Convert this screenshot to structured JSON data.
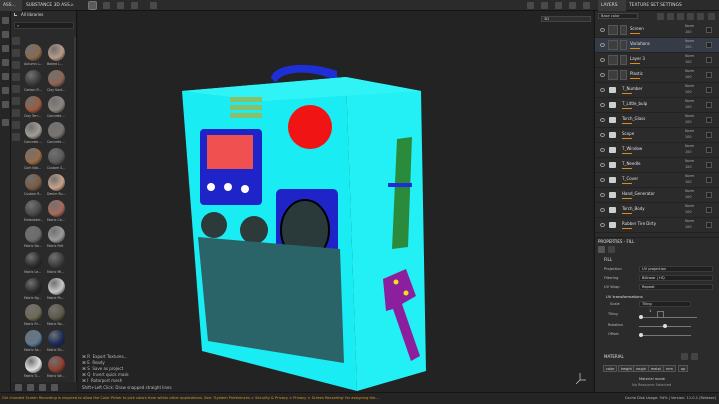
{
  "top_tabs": [
    {
      "label": "ASS..."
    },
    {
      "label": "SUBSTANCE 3D ASS..."
    },
    {
      "label": "LAYERS"
    },
    {
      "label": "TEXTURE SET SETTINGS"
    }
  ],
  "viewport": {
    "material_dropdown": "Base color",
    "camera_dropdown": "3D",
    "shortcuts": [
      {
        "key": "⌘ R",
        "label": "Export Textures..."
      },
      {
        "key": "⌘ E",
        "label": "Ready"
      },
      {
        "key": "⌘ S",
        "label": "Save as project"
      },
      {
        "key": "⌘ Q",
        "label": "Invert quick mask"
      },
      {
        "key": "⌘ I",
        "label": "Rotorport mesh"
      }
    ],
    "hint": "Shift+Left Click: Draw snapped straight lines"
  },
  "shelf": {
    "title": "All libraries",
    "search_placeholder": "",
    "items": [
      {
        "label": "Autumn L...",
        "color": "#8a6a4c"
      },
      {
        "label": "Baked L...",
        "color": "#b89a86"
      },
      {
        "label": "Carbon Fi...",
        "color": "#3a3a3a"
      },
      {
        "label": "Clay Sant...",
        "color": "#8d6654"
      },
      {
        "label": "Clay Terr...",
        "color": "#9b5a3d"
      },
      {
        "label": "Concrete ...",
        "color": "#8b8680"
      },
      {
        "label": "Concrete ...",
        "color": "#a19c96"
      },
      {
        "label": "Concrete ...",
        "color": "#797470"
      },
      {
        "label": "Cork Nat...",
        "color": "#9a6b46"
      },
      {
        "label": "Custom S...",
        "color": "#5a5a5a"
      },
      {
        "label": "Custom R...",
        "color": "#7a5a44"
      },
      {
        "label": "Denim Ru...",
        "color": "#c9a28a"
      },
      {
        "label": "Embroider...",
        "color": "#4a4a4a"
      },
      {
        "label": "Fabric Ca...",
        "color": "#a86a5a"
      },
      {
        "label": "Fabric Da...",
        "color": "#6c6c6c"
      },
      {
        "label": "Fabric Felt",
        "color": "#9a9a9a"
      },
      {
        "label": "Fabric Le...",
        "color": "#2c2c2c"
      },
      {
        "label": "Fabric Mi...",
        "color": "#3c3c3c"
      },
      {
        "label": "Fabric Ny...",
        "color": "#2a2a2a"
      },
      {
        "label": "Fabric Pu...",
        "color": "#c8c8c8"
      },
      {
        "label": "Fabric Ri...",
        "color": "#6e6a55"
      },
      {
        "label": "Fabric Ro...",
        "color": "#5e5a48"
      },
      {
        "label": "Fabric Sa...",
        "color": "#5d7a92"
      },
      {
        "label": "Fabric Sh...",
        "color": "#1c2a5c"
      },
      {
        "label": "Fabric Ti...",
        "color": "#e0e0e0"
      },
      {
        "label": "Fabric Wr...",
        "color": "#8e3f2e"
      }
    ]
  },
  "layers": {
    "blend_mode": "Base color",
    "items": [
      {
        "name": "Screen",
        "kind": "fill",
        "blend": "Norm",
        "opacity": "100"
      },
      {
        "name": "Variations",
        "kind": "fill",
        "blend": "Norm",
        "opacity": "100"
      },
      {
        "name": "Layer 3",
        "kind": "paint",
        "blend": "Norm",
        "opacity": "100"
      },
      {
        "name": "Plastic",
        "kind": "fill",
        "blend": "Norm",
        "opacity": "100"
      },
      {
        "name": "T_Number",
        "kind": "folder",
        "blend": "Norm",
        "opacity": "100"
      },
      {
        "name": "T_Little_bulp",
        "kind": "folder",
        "blend": "Norm",
        "opacity": "100"
      },
      {
        "name": "Torch_Glass",
        "kind": "folder",
        "blend": "Norm",
        "opacity": "100"
      },
      {
        "name": "Scope",
        "kind": "folder",
        "blend": "Norm",
        "opacity": "100"
      },
      {
        "name": "T_Window",
        "kind": "folder",
        "blend": "Norm",
        "opacity": "100"
      },
      {
        "name": "T_Needle",
        "kind": "folder",
        "blend": "Norm",
        "opacity": "100"
      },
      {
        "name": "T_Cover",
        "kind": "folder",
        "blend": "Norm",
        "opacity": "100"
      },
      {
        "name": "Hand_Generator",
        "kind": "folder",
        "blend": "Norm",
        "opacity": "100"
      },
      {
        "name": "Torch_Body",
        "kind": "folder",
        "blend": "Norm",
        "opacity": "100"
      },
      {
        "name": "Rubber Tire Dirty",
        "kind": "folder",
        "blend": "Norm",
        "opacity": "100"
      }
    ]
  },
  "properties": {
    "title": "PROPERTIES - FILL",
    "fill_section": "FILL",
    "projection_label": "Projection",
    "projection_value": "UV projection",
    "filtering_label": "Filtering",
    "filtering_value": "Bilinear | HQ",
    "uvwrap_label": "UV Wrap",
    "uvwrap_value": "Repeat",
    "uv_transformations": "UV transformations",
    "scale_label": "Scale",
    "scale_value": "Tiling",
    "tiling_label": "Tiling",
    "tiling_value": "1",
    "rotation_label": "Rotation",
    "offset_label": "Offset",
    "material_section": "MATERIAL",
    "channels": [
      "color",
      "height",
      "rough",
      "metal",
      "nrm",
      "op"
    ],
    "material_mode_label": "Material mode",
    "material_mode_value": "No Resource Selected"
  },
  "status": {
    "message": "Ctrl chorded Screen Recording is required to allow the Color Picker to pick colors from within other applications. See: 'System Preferences > Security & Privacy > Privacy > Screen Recording' for assigning the...",
    "right": "Cache Disk Usage: 94% | Version: 11.0.1 (Release)"
  }
}
